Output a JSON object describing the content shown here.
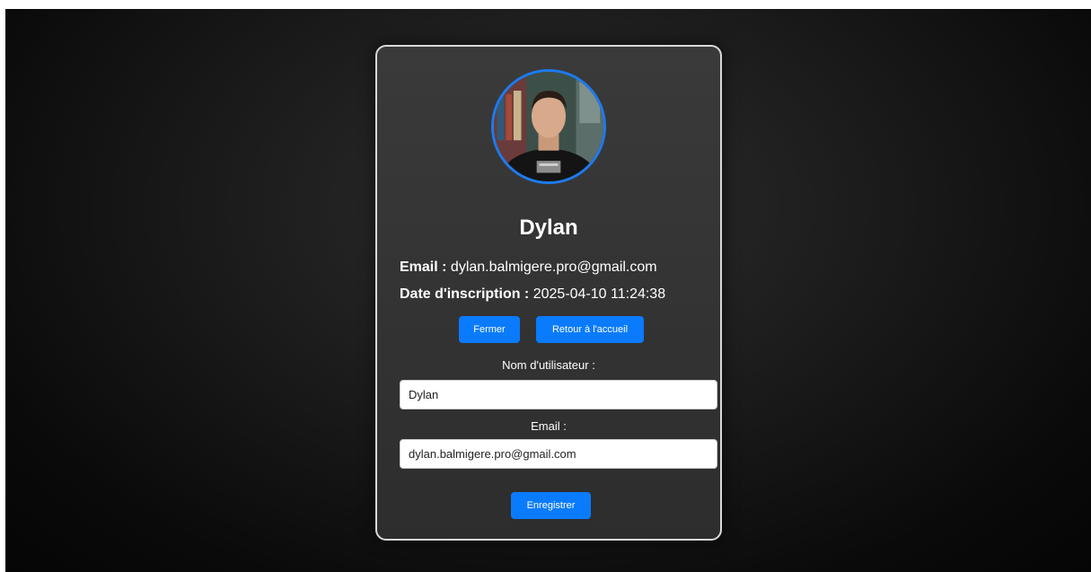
{
  "profile": {
    "avatar_alt": "Photo de profil",
    "display_name": "Dylan",
    "email_label": "Email :",
    "email_value": "dylan.balmigere.pro@gmail.com",
    "date_label": "Date d'inscription :",
    "date_value": "2025-04-10 11:24:38"
  },
  "actions": {
    "close_label": "Fermer",
    "home_label": "Retour à l'accueil"
  },
  "form": {
    "username_label": "Nom d'utilisateur :",
    "username_value": "Dylan",
    "email_label": "Email :",
    "email_value": "dylan.balmigere.pro@gmail.com",
    "save_label": "Enregistrer"
  },
  "colors": {
    "accent": "#0a7bfc",
    "avatar_ring": "#1d7bf0",
    "card_background": "#353535",
    "card_border": "#d9d9d9",
    "page_background": "#0a0a0a"
  }
}
